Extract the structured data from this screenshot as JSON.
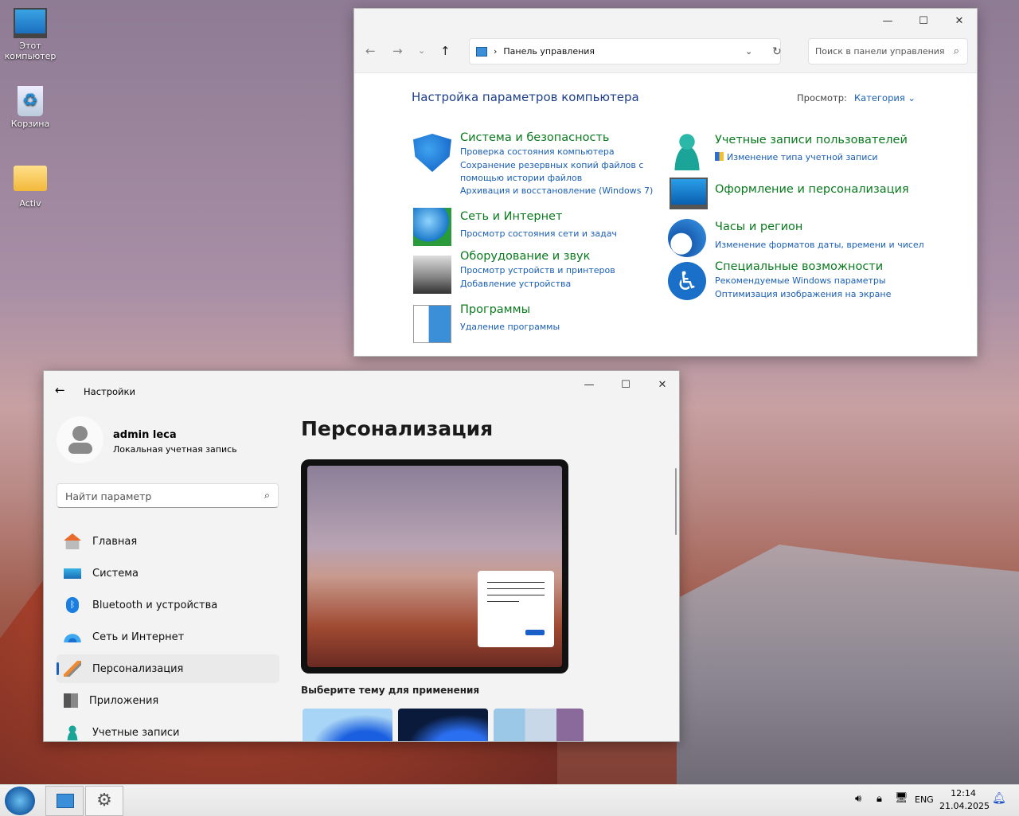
{
  "desktop": {
    "icons": [
      {
        "label": "Этот компьютер"
      },
      {
        "label": "Корзина"
      },
      {
        "label": "Activ"
      }
    ]
  },
  "control_panel": {
    "address": "Панель управления",
    "search_placeholder": "Поиск в панели управления",
    "heading": "Настройка параметров компьютера",
    "view_label": "Просмотр:",
    "view_value": "Категория",
    "categories": [
      {
        "title": "Система и безопасность",
        "links": [
          "Проверка состояния компьютера",
          "Сохранение резервных копий файлов с",
          "помощью истории файлов",
          "Архивация и восстановление (Windows 7)"
        ]
      },
      {
        "title": "Сеть и Интернет",
        "links": [
          "Просмотр состояния сети и задач"
        ]
      },
      {
        "title": "Оборудование и звук",
        "links": [
          "Просмотр устройств и принтеров",
          "Добавление устройства"
        ]
      },
      {
        "title": "Программы",
        "links": [
          "Удаление программы"
        ]
      },
      {
        "title": "Учетные записи пользователей",
        "links": [
          "Изменение типа учетной записи"
        ]
      },
      {
        "title": "Оформление и персонализация",
        "links": []
      },
      {
        "title": "Часы и регион",
        "links": [
          "Изменение форматов даты, времени и чисел"
        ]
      },
      {
        "title": "Специальные возможности",
        "links": [
          "Рекомендуемые Windows параметры",
          "Оптимизация изображения на экране"
        ]
      }
    ]
  },
  "settings": {
    "title": "Настройки",
    "user_name": "admin leca",
    "account_type": "Локальная учетная запись",
    "search_placeholder": "Найти параметр",
    "nav": [
      {
        "label": "Главная"
      },
      {
        "label": "Система"
      },
      {
        "label": "Bluetooth и устройства"
      },
      {
        "label": "Сеть и Интернет"
      },
      {
        "label": "Персонализация"
      },
      {
        "label": "Приложения"
      },
      {
        "label": "Учетные записи"
      }
    ],
    "page_title": "Персонализация",
    "theme_heading": "Выберите тему для применения"
  },
  "taskbar": {
    "lang": "ENG",
    "time": "12:14",
    "date": "21.04.2025"
  }
}
